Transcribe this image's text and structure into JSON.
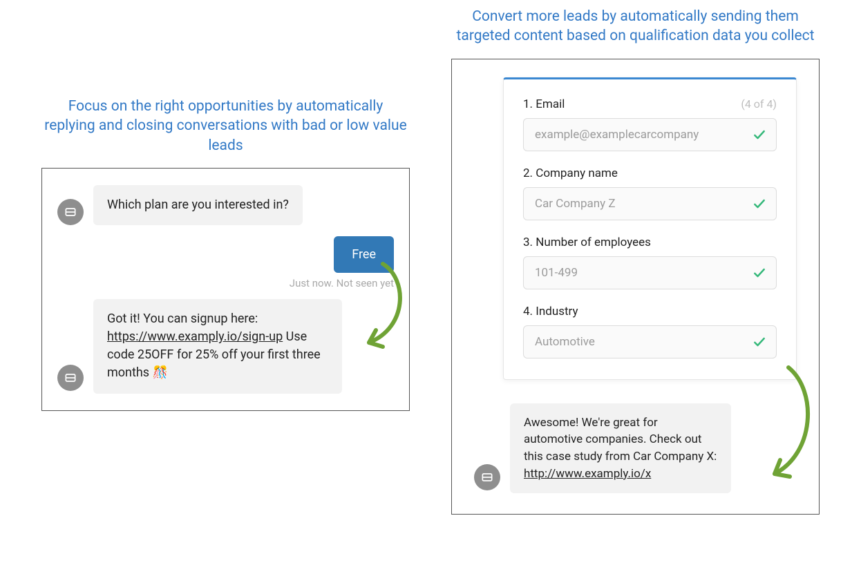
{
  "left": {
    "headline": "Focus on the right opportunities by automatically replying and closing conversations with bad or low value leads",
    "bot_q": "Which plan are you interested in?",
    "user_reply": "Free",
    "meta": "Just now. Not seen yet",
    "bot_followup_pre": "Got it! You can signup here: ",
    "bot_followup_link": "https://www.examply.io/sign-up",
    "bot_followup_post": " Use code 25OFF for 25% off your first three months 🎊"
  },
  "right": {
    "headline": "Convert more leads by automatically sending them targeted content based on qualification data you collect",
    "counter": "(4 of 4)",
    "fields": {
      "f1": {
        "label": "1. Email",
        "value": "example@examplecarcompany"
      },
      "f2": {
        "label": "2. Company name",
        "value": "Car Company Z"
      },
      "f3": {
        "label": "3. Number of employees",
        "value": "101-499"
      },
      "f4": {
        "label": "4. Industry",
        "value": "Automotive"
      }
    },
    "bot_reply_pre": "Awesome! We're great for automotive companies. Check out this case study from Car Company X: ",
    "bot_reply_link": "http://www.examply.io/x"
  }
}
